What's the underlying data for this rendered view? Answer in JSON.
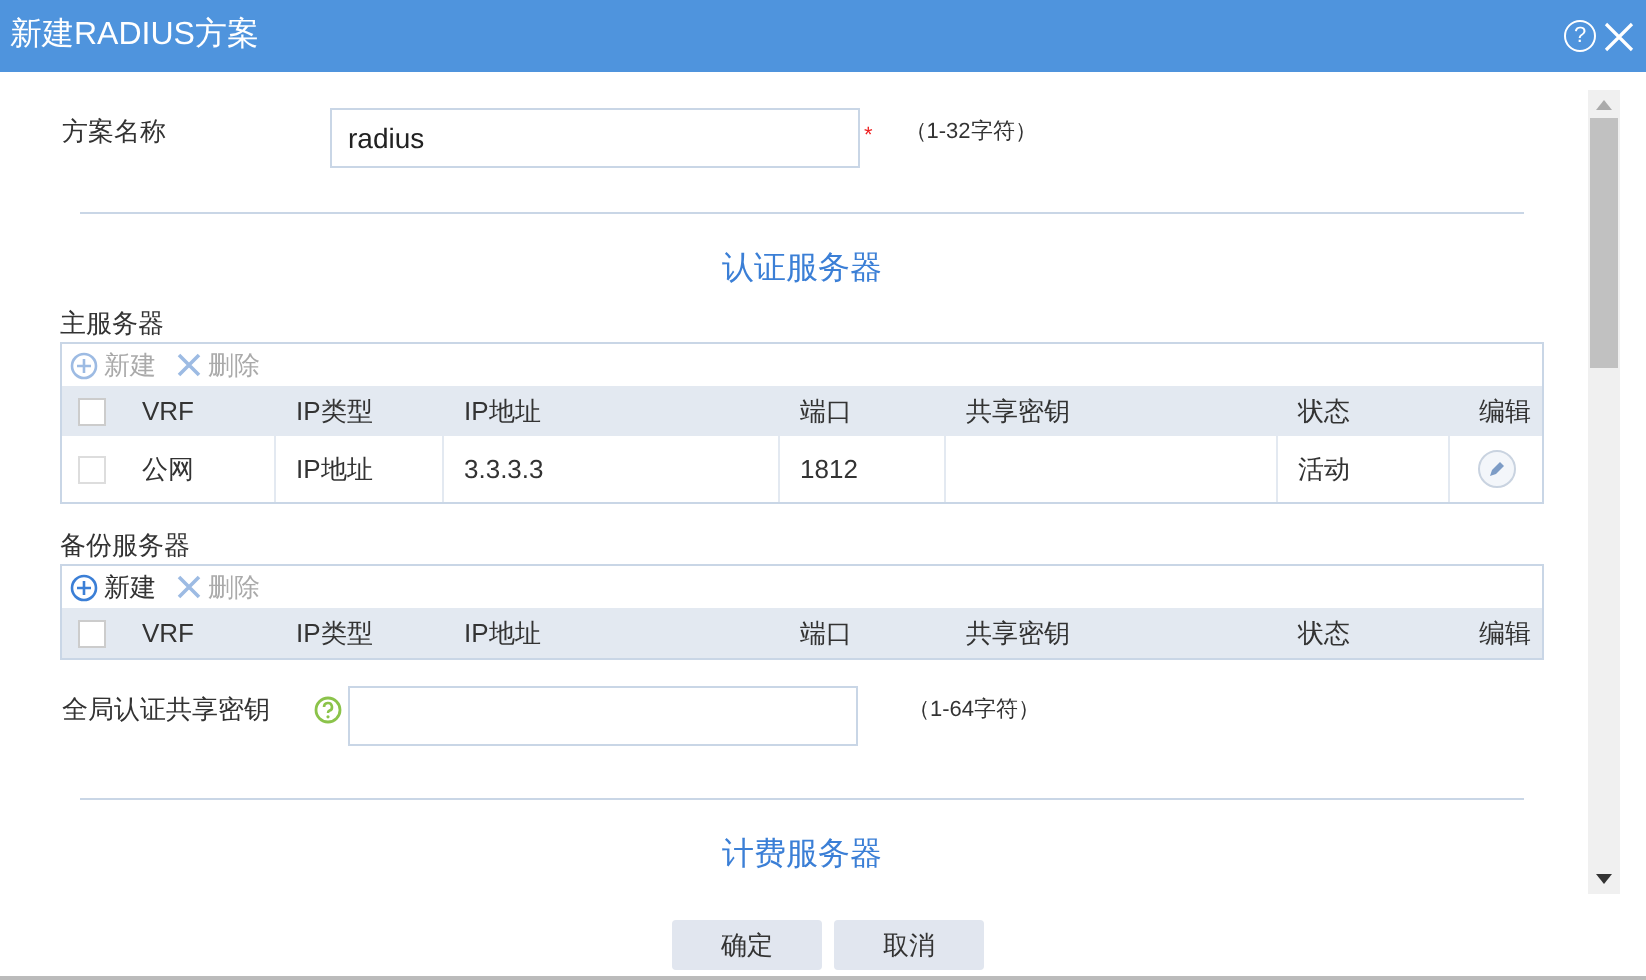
{
  "window": {
    "title": "新建RADIUS方案",
    "help": "?"
  },
  "scheme_name": {
    "label": "方案名称",
    "value": "radius",
    "required_mark": "*",
    "hint": "（1-32字符）"
  },
  "auth_section": {
    "title": "认证服务器"
  },
  "server_tables": [
    {
      "title": "主服务器",
      "actions": [
        {
          "label": "新建",
          "kind": "add",
          "disabled": true
        },
        {
          "label": "删除",
          "kind": "delete",
          "disabled": true
        }
      ],
      "all_checked": false,
      "columns": [
        "VRF",
        "IP类型",
        "IP地址",
        "端口",
        "共享密钥",
        "状态",
        "编辑"
      ],
      "rows": [
        {
          "checked": false,
          "cells": [
            "公网",
            "IP地址",
            "3.3.3.3",
            "1812",
            "",
            "活动"
          ]
        }
      ]
    },
    {
      "title": "备份服务器",
      "actions": [
        {
          "label": "新建",
          "kind": "add",
          "disabled": false
        },
        {
          "label": "删除",
          "kind": "delete",
          "disabled": true
        }
      ],
      "all_checked": false,
      "columns": [
        "VRF",
        "IP类型",
        "IP地址",
        "端口",
        "共享密钥",
        "状态",
        "编辑"
      ]
    }
  ],
  "global_key": {
    "label": "全局认证共享密钥",
    "hint": "（1-64字符）"
  },
  "accounting_section": {
    "title": "计费服务器"
  },
  "buttons": [
    "确定",
    "取消"
  ]
}
